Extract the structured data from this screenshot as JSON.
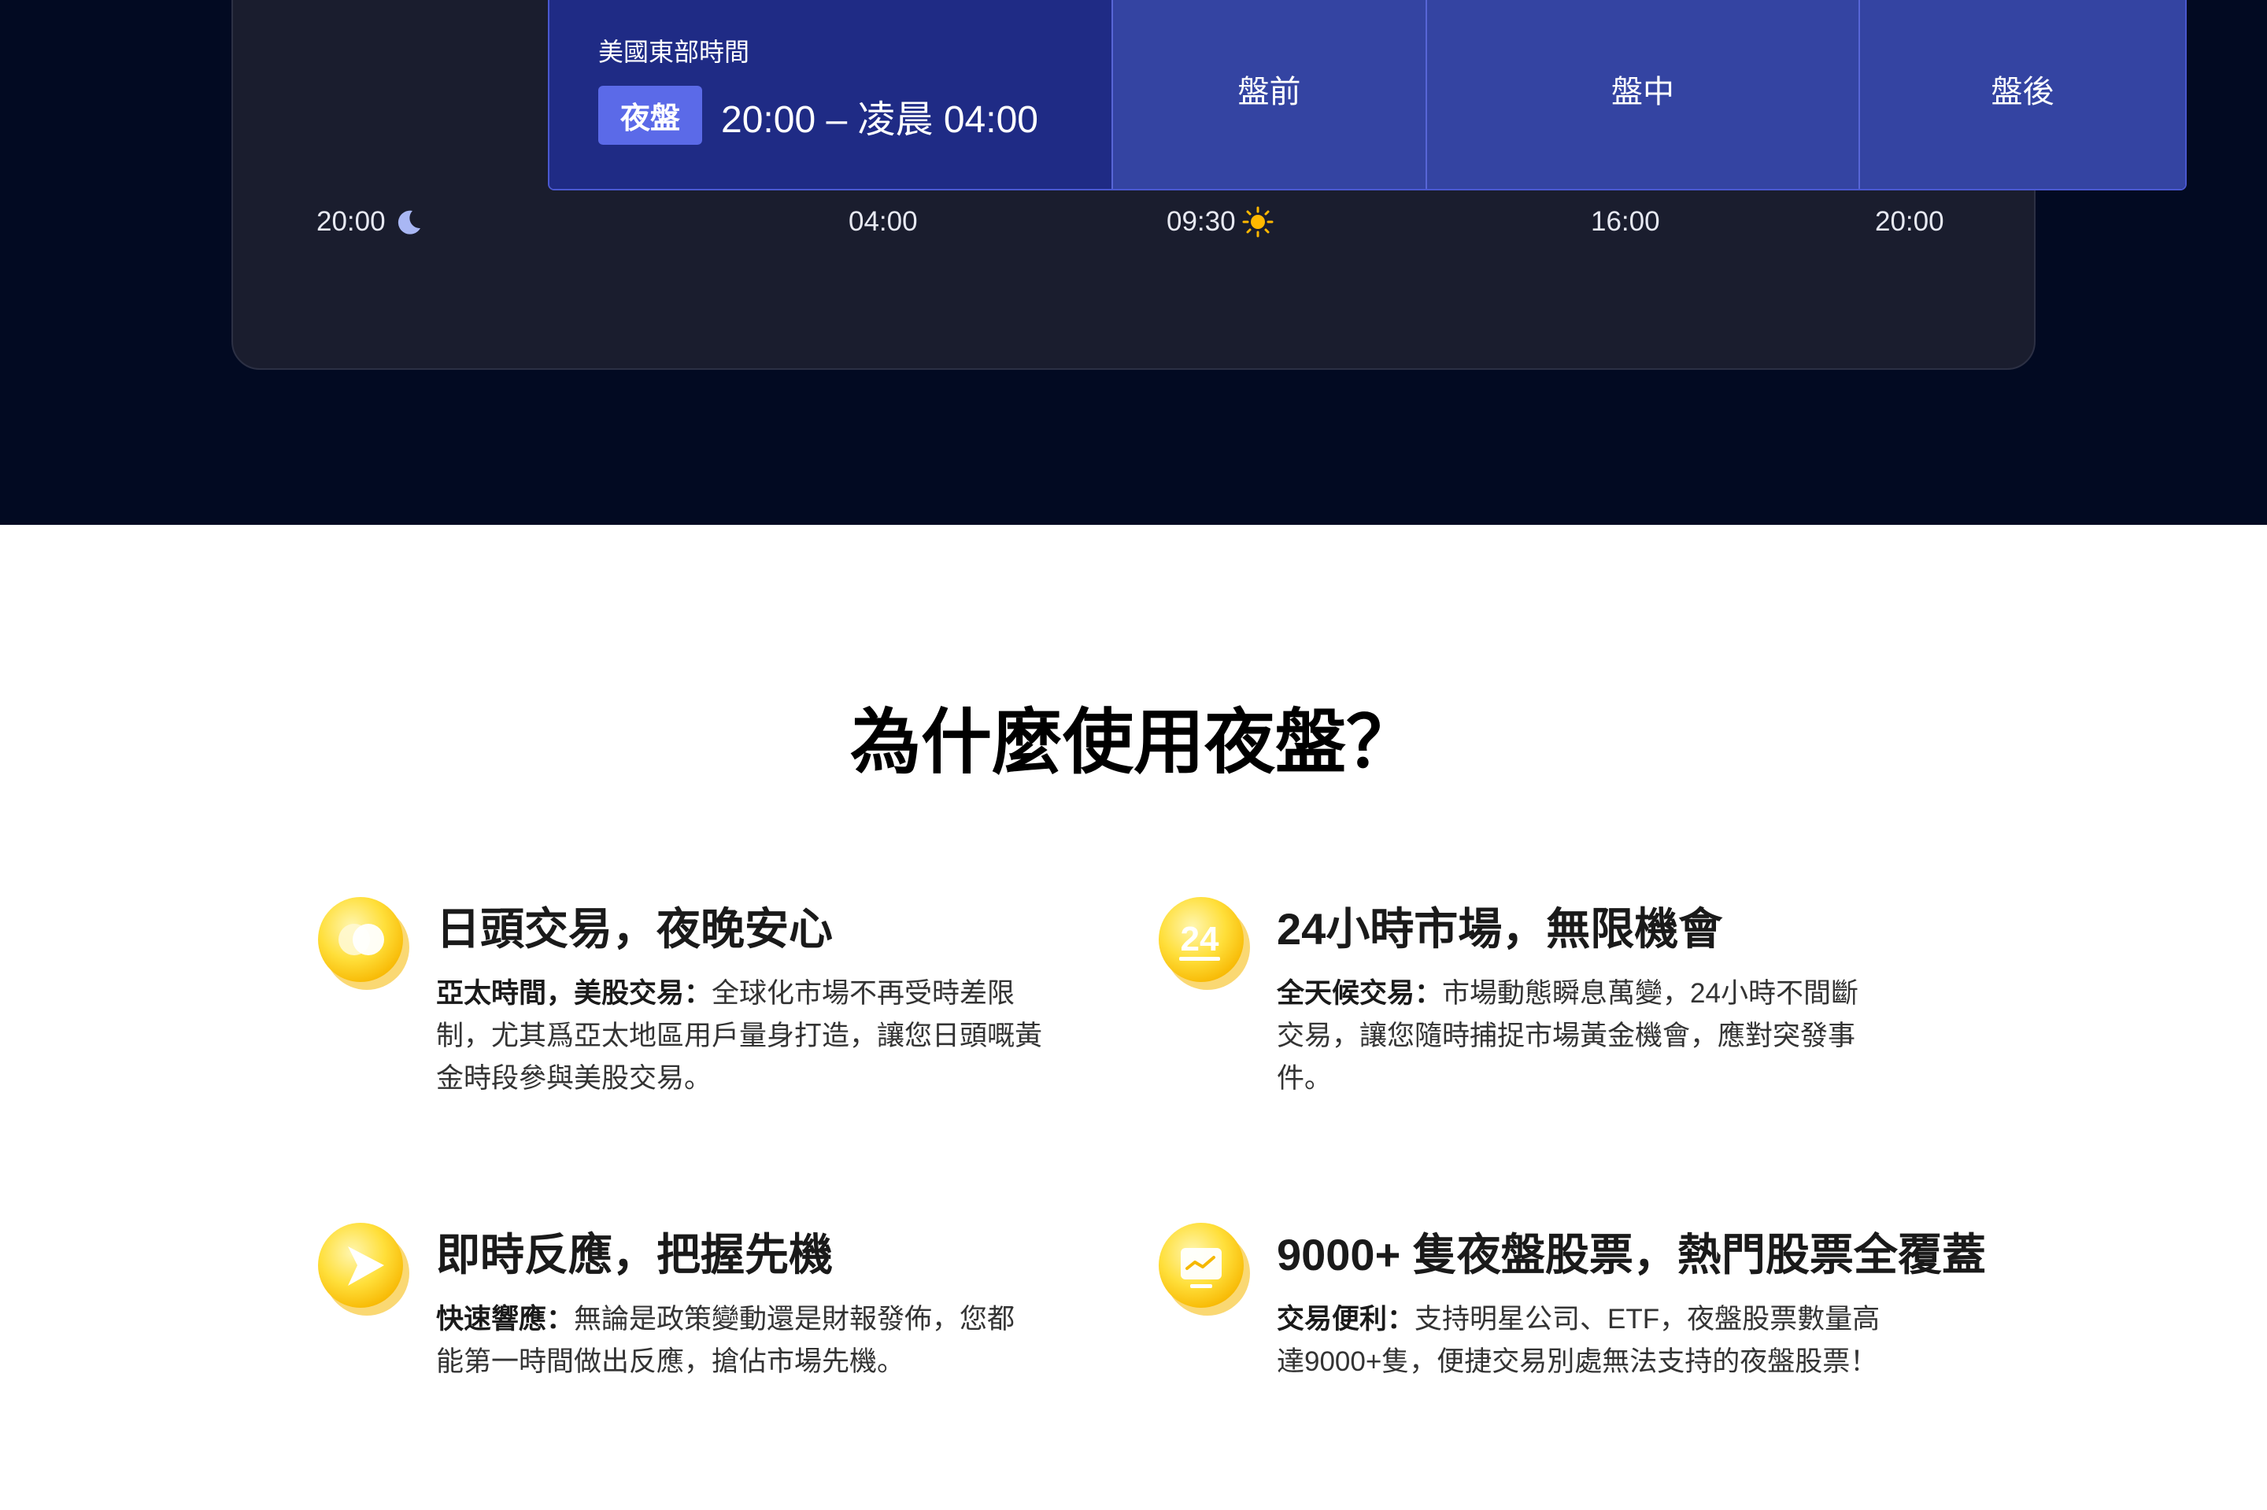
{
  "timeline": {
    "timezone_label": "美國東部時間",
    "night_badge": "夜盤",
    "night_range": "20:00 – 凌晨 04:00",
    "segments": [
      "盤前",
      "盤中",
      "盤後"
    ],
    "ticks": [
      "20:00",
      "04:00",
      "09:30",
      "16:00",
      "20:00"
    ]
  },
  "section": {
    "title": "為什麼使用夜盤？"
  },
  "features": [
    {
      "title": "日頭交易，夜晚安心",
      "lead": "亞太時間，美股交易：",
      "body": "全球化市場不再受時差限制，尤其爲亞太地區用戶量身打造，讓您日頭嘅黃金時段參與美股交易。",
      "icon": "coins-icon"
    },
    {
      "title": "24小時市場，無限機會",
      "lead": "全天候交易：",
      "body": "市場動態瞬息萬變，24小時不間斷交易，讓您隨時捕捉市場黃金機會，應對突發事件。",
      "icon": "24-hours-icon"
    },
    {
      "title": "即時反應，把握先機",
      "lead": "快速響應：",
      "body": "無論是政策變動還是財報發佈，您都能第一時間做出反應，搶佔市場先機。",
      "icon": "play-arrow-icon"
    },
    {
      "title": "9000+ 隻夜盤股票，熱門股票全覆蓋",
      "lead": "交易便利：",
      "body": "支持明星公司、ETF，夜盤股票數量高達9000+隻，便捷交易別處無法支持的夜盤股票！",
      "icon": "chart-screen-icon"
    }
  ],
  "colors": {
    "dark_bg": "#020a22",
    "night_segment": "#1f2b85",
    "day_segment": "#3444a2",
    "badge": "#5b6ae8",
    "coin": "#ffd43b"
  }
}
